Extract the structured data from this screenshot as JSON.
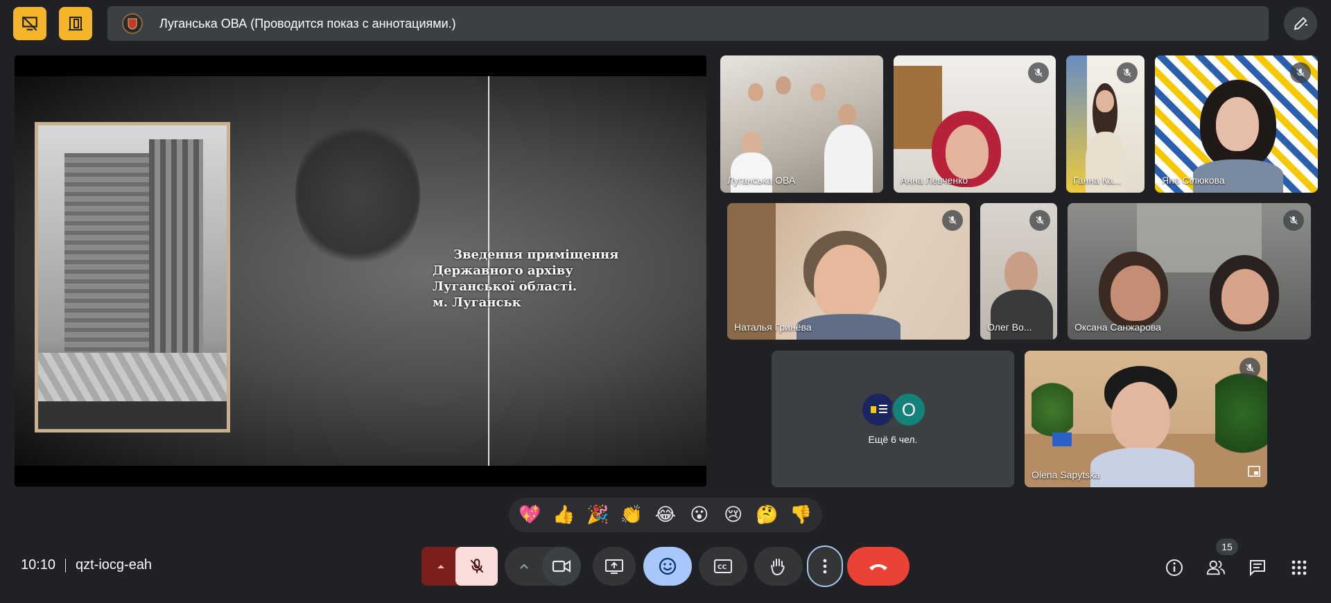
{
  "header": {
    "meeting_title": "Луганська ОВА (Проводится показ с аннотациями.)",
    "icons": [
      "no-presentation-icon",
      "door-icon",
      "pen-icon"
    ]
  },
  "presentation": {
    "caption_lines": [
      "Зведення приміщення",
      "Державного архіву",
      "Луганської області.",
      "м. Луганськ"
    ]
  },
  "participants": [
    {
      "name": "Луганська ОВА",
      "muted": false
    },
    {
      "name": "Анна Левченко",
      "muted": true
    },
    {
      "name": "Ганна Ка...",
      "muted": true
    },
    {
      "name": "Яна Сілюкова",
      "muted": true
    },
    {
      "name": "Наталья Гринёва",
      "muted": true
    },
    {
      "name": "Олег Во...",
      "muted": true
    },
    {
      "name": "Оксана Санжарова",
      "muted": true
    },
    {
      "name": "Olena Sapytska",
      "muted": true
    }
  ],
  "more": {
    "avatar_letter": "О",
    "label": "Ещё 6 чел."
  },
  "reactions": [
    "💖",
    "👍",
    "🎉",
    "👏",
    "😂",
    "😮",
    "😢",
    "🤔",
    "👎"
  ],
  "footer": {
    "time": "10:10",
    "meeting_code": "qzt-iocg-eah",
    "people_count": "15"
  },
  "colors": {
    "background": "#202124",
    "accent_yellow": "#f5b52a",
    "end_call_red": "#ea4335",
    "mic_off_bg": "#f9dedc",
    "reactions_active": "#a8c7fa"
  }
}
